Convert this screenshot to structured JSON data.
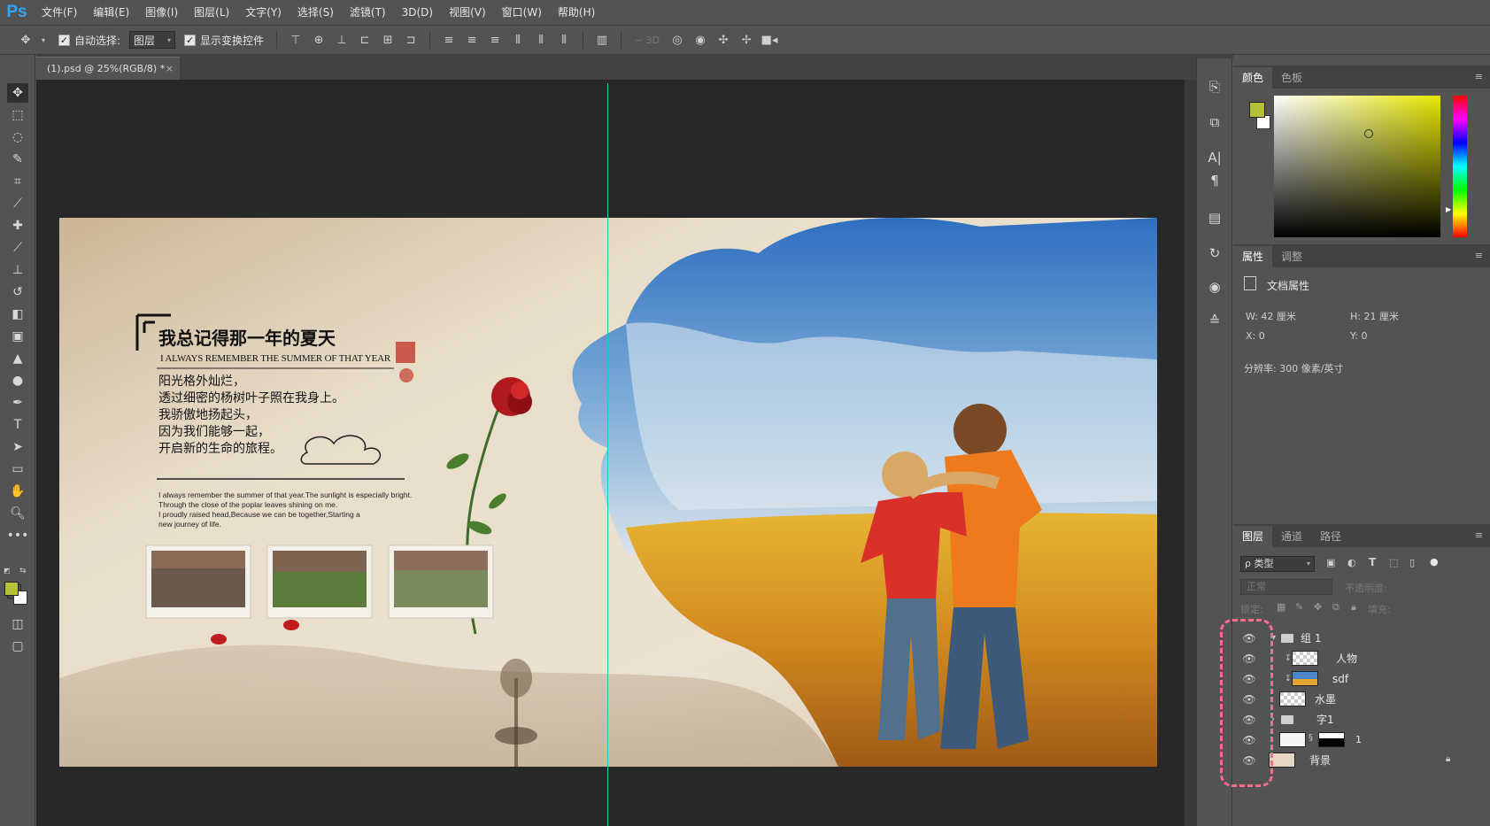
{
  "app": {
    "logo": "Ps"
  },
  "menu": [
    "文件(F)",
    "编辑(E)",
    "图像(I)",
    "图层(L)",
    "文字(Y)",
    "选择(S)",
    "滤镜(T)",
    "3D(D)",
    "视图(V)",
    "窗口(W)",
    "帮助(H)"
  ],
  "options": {
    "auto_select_label": "自动选择:",
    "auto_select_value": "图层",
    "show_transform_label": "显示变换控件"
  },
  "document_tab": {
    "title": "(1).psd @ 25%(RGB/8) *",
    "close": "×"
  },
  "artwork": {
    "title_cn": "我总记得那一年的夏天",
    "title_en": "I ALWAYS REMEMBER THE SUMMER OF THAT YEAR",
    "poem": [
      "阳光格外灿烂，",
      "透过细密的杨树叶子照在我身上。",
      "我骄傲地扬起头，",
      "因为我们能够一起，",
      "开启新的生命的旅程。"
    ],
    "body_en": [
      "I always remember the summer of that year.The sunlight is especially bright.",
      "Through the close of the poplar leaves shining on me.",
      "I proudly raised head,Because we can be together,Starting a",
      "new journey of life."
    ]
  },
  "color_panel": {
    "tabs": [
      "颜色",
      "色板"
    ],
    "fg": "#b6c13a",
    "bg": "#ffffff"
  },
  "properties_panel": {
    "tabs": [
      "属性",
      "调整"
    ],
    "heading": "文档属性",
    "w": "W:  42 厘米",
    "h": "H:  21 厘米",
    "x": "X:  0",
    "y": "Y:  0",
    "resolution": "分辨率: 300 像素/英寸"
  },
  "layers_panel": {
    "tabs": [
      "图层",
      "通道",
      "路径"
    ],
    "filter": "ρ 类型",
    "blend_mode": "正常",
    "opacity_label": "不透明度:",
    "lock_label": "锁定:",
    "fill_label": "填充:",
    "layers": [
      {
        "name": "组 1"
      },
      {
        "name": "人物"
      },
      {
        "name": "sdf"
      },
      {
        "name": "水墨"
      },
      {
        "name": "字1"
      },
      {
        "name": "1"
      },
      {
        "name": "背景"
      }
    ]
  }
}
